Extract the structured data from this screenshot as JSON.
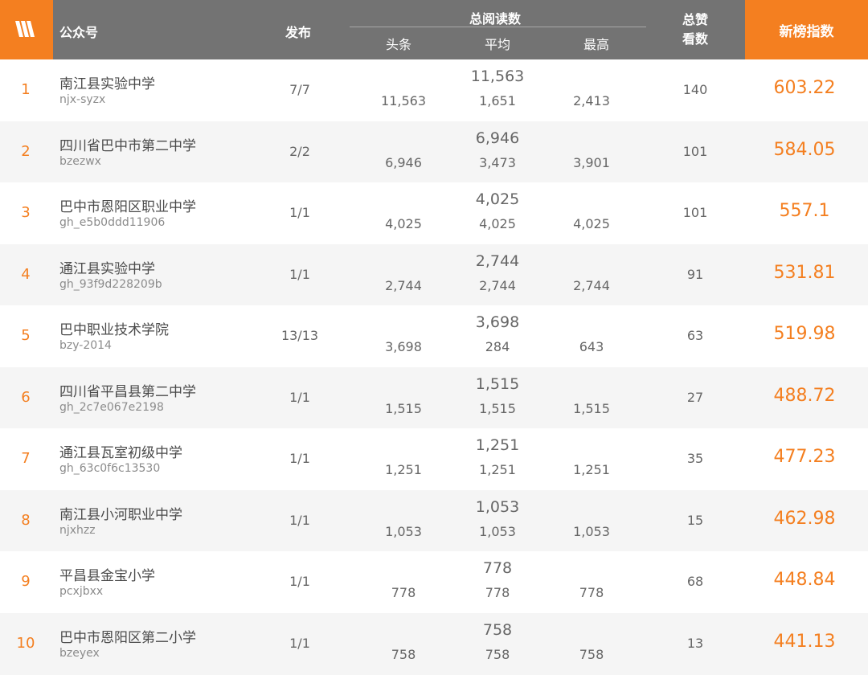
{
  "header": {
    "account": "公众号",
    "publish": "发布",
    "total_reads": "总阅读数",
    "headline": "头条",
    "average": "平均",
    "highest": "最高",
    "likes_line1": "总赞",
    "likes_line2": "看数",
    "index": "新榜指数",
    "logo_icon": "newrank-logo-icon"
  },
  "colors": {
    "accent": "#f47f20",
    "header_bg": "#737373",
    "row_alt": "#f5f5f5",
    "text": "#4a4a4a",
    "muted": "#8c8c8c"
  },
  "rows": [
    {
      "rank": "1",
      "name": "南江县实验中学",
      "account": "njx-syzx",
      "publish": "7/7",
      "total": "11,563",
      "headline": "11,563",
      "average": "1,651",
      "highest": "2,413",
      "likes": "140",
      "index": "603.22"
    },
    {
      "rank": "2",
      "name": "四川省巴中市第二中学",
      "account": "bzezwx",
      "publish": "2/2",
      "total": "6,946",
      "headline": "6,946",
      "average": "3,473",
      "highest": "3,901",
      "likes": "101",
      "index": "584.05"
    },
    {
      "rank": "3",
      "name": "巴中市恩阳区职业中学",
      "account": "gh_e5b0ddd11906",
      "publish": "1/1",
      "total": "4,025",
      "headline": "4,025",
      "average": "4,025",
      "highest": "4,025",
      "likes": "101",
      "index": "557.1"
    },
    {
      "rank": "4",
      "name": "通江县实验中学",
      "account": "gh_93f9d228209b",
      "publish": "1/1",
      "total": "2,744",
      "headline": "2,744",
      "average": "2,744",
      "highest": "2,744",
      "likes": "91",
      "index": "531.81"
    },
    {
      "rank": "5",
      "name": "巴中职业技术学院",
      "account": "bzy-2014",
      "publish": "13/13",
      "total": "3,698",
      "headline": "3,698",
      "average": "284",
      "highest": "643",
      "likes": "63",
      "index": "519.98"
    },
    {
      "rank": "6",
      "name": "四川省平昌县第二中学",
      "account": "gh_2c7e067e2198",
      "publish": "1/1",
      "total": "1,515",
      "headline": "1,515",
      "average": "1,515",
      "highest": "1,515",
      "likes": "27",
      "index": "488.72"
    },
    {
      "rank": "7",
      "name": "通江县瓦室初级中学",
      "account": "gh_63c0f6c13530",
      "publish": "1/1",
      "total": "1,251",
      "headline": "1,251",
      "average": "1,251",
      "highest": "1,251",
      "likes": "35",
      "index": "477.23"
    },
    {
      "rank": "8",
      "name": "南江县小河职业中学",
      "account": "njxhzz",
      "publish": "1/1",
      "total": "1,053",
      "headline": "1,053",
      "average": "1,053",
      "highest": "1,053",
      "likes": "15",
      "index": "462.98"
    },
    {
      "rank": "9",
      "name": "平昌县金宝小学",
      "account": "pcxjbxx",
      "publish": "1/1",
      "total": "778",
      "headline": "778",
      "average": "778",
      "highest": "778",
      "likes": "68",
      "index": "448.84"
    },
    {
      "rank": "10",
      "name": "巴中市恩阳区第二小学",
      "account": "bzeyex",
      "publish": "1/1",
      "total": "758",
      "headline": "758",
      "average": "758",
      "highest": "758",
      "likes": "13",
      "index": "441.13"
    }
  ]
}
